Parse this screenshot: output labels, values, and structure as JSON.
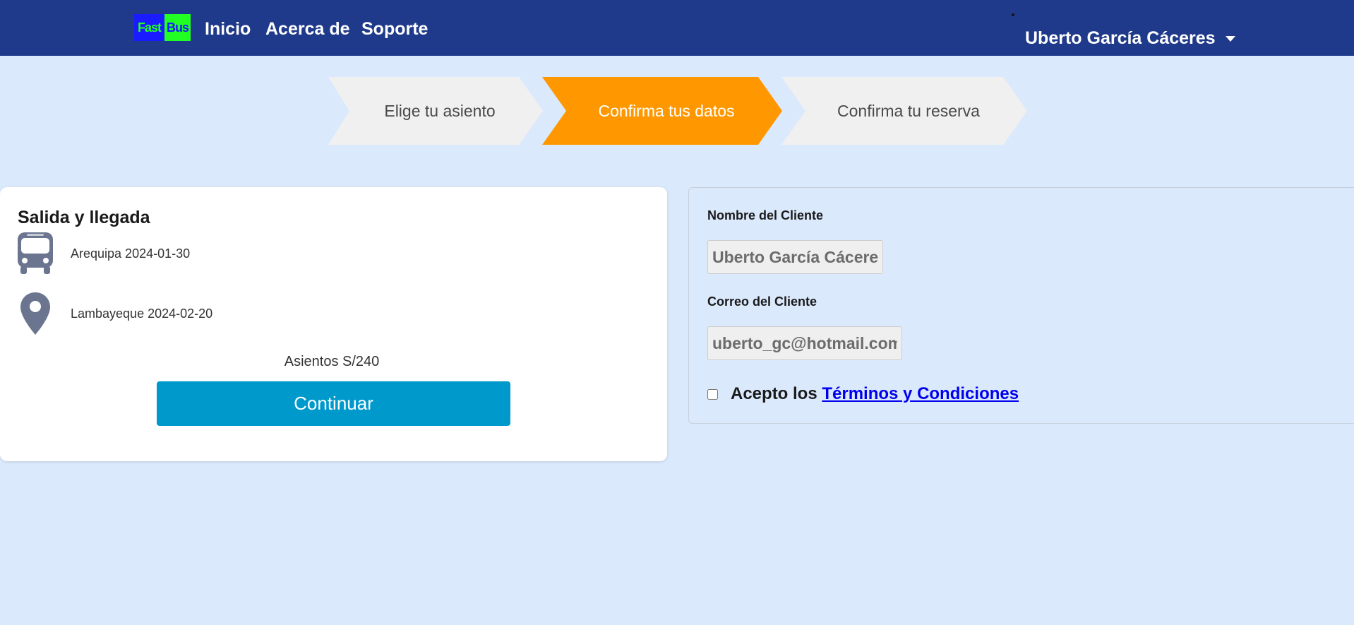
{
  "navbar": {
    "logo_part1": "Fast",
    "logo_part2": "Bus",
    "links": [
      {
        "label": "Inicio"
      },
      {
        "label": "Acerca de"
      },
      {
        "label": "Soporte"
      }
    ],
    "user_name": "Uberto García Cáceres",
    "background_color": "#1f3a8a"
  },
  "steps": [
    {
      "label": "Elige tu asiento",
      "active": false
    },
    {
      "label": "Confirma tus datos",
      "active": true
    },
    {
      "label": "Confirma tu reserva",
      "active": false
    }
  ],
  "trip": {
    "title": "Salida y llegada",
    "departure": "Arequipa 2024-01-30",
    "arrival": "Lambayeque 2024-02-20",
    "seats_summary": "Asientos S/240",
    "continue_label": "Continuar",
    "icons": {
      "departure": "bus-icon",
      "arrival": "map-pin-icon"
    }
  },
  "client": {
    "name_label": "Nombre del Cliente",
    "name_value": "Uberto García Cáceres",
    "email_label": "Correo del Cliente",
    "email_value": "uberto_gc@hotmail.com",
    "terms_prefix": "Acepto los",
    "terms_link": "Términos y Condiciones",
    "terms_checked": false
  },
  "colors": {
    "page_background": "#dbe9fc",
    "active_step": "#ff9800",
    "inactive_step": "#f0f0f0",
    "continue_button": "#0099cc",
    "icon": "#6b7590"
  }
}
